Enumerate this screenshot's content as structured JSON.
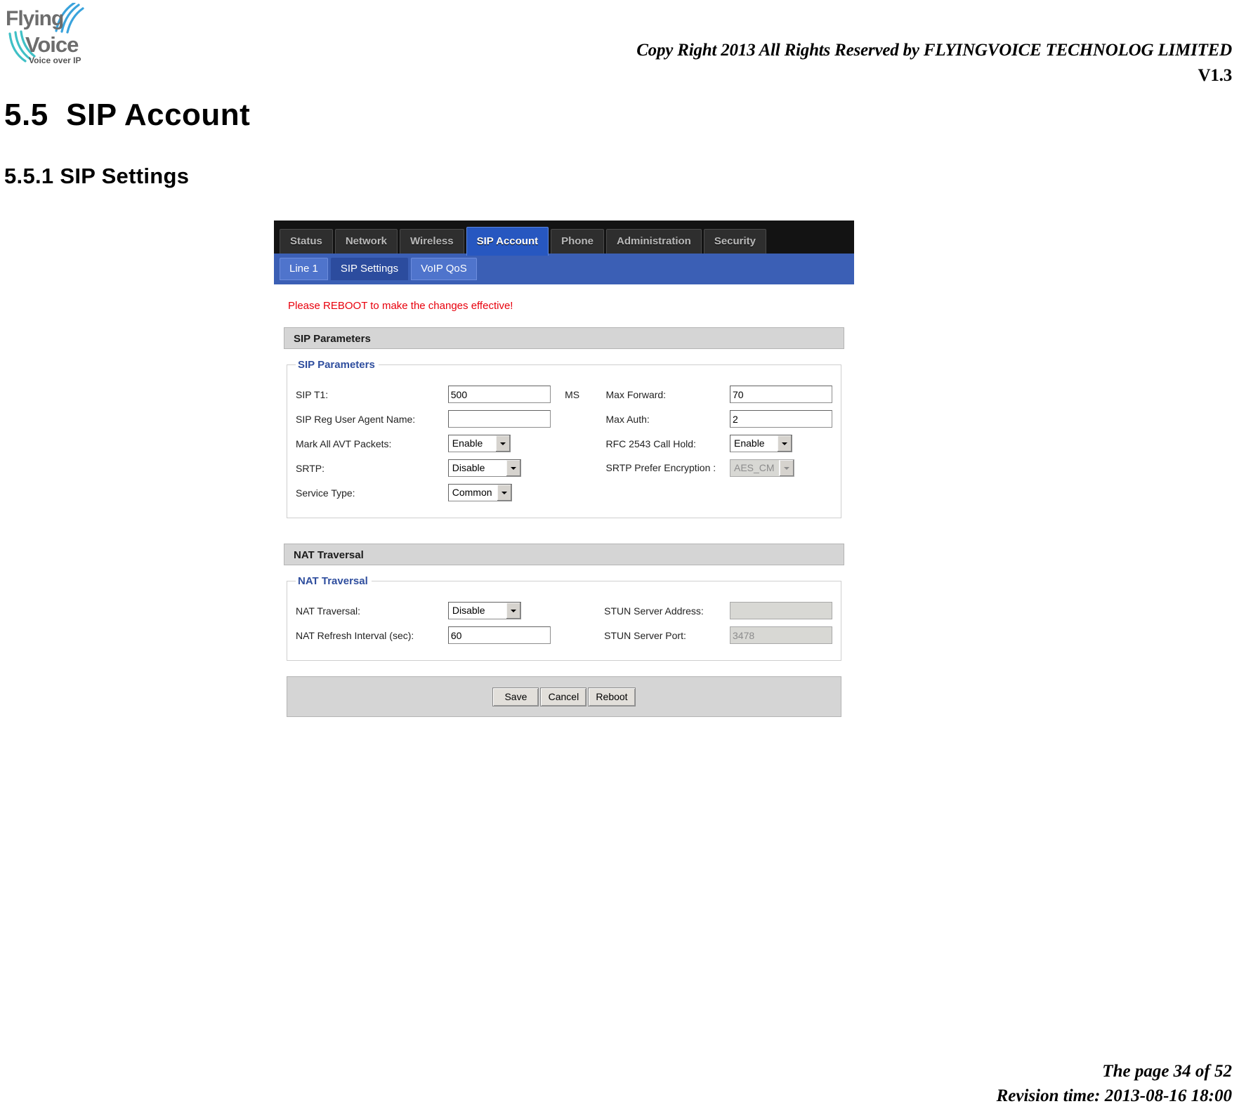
{
  "document": {
    "header_copyright": "Copy Right 2013 All Rights Reserved by FLYINGVOICE TECHNOLOG LIMITED",
    "header_version": "V1.3",
    "logo_alt": "Flying Voice — Voice over IP",
    "logo_line1": "Flying",
    "logo_line2": "Voice",
    "logo_tagline": "Voice over IP",
    "section_title": "5.5  SIP Account",
    "subsection_title": "5.5.1 SIP Settings",
    "footer_page": "The page 34 of 52",
    "footer_revision": "Revision time: 2013-08-16 18:00"
  },
  "webui": {
    "nav_tabs": [
      {
        "label": "Status",
        "active": false
      },
      {
        "label": "Network",
        "active": false
      },
      {
        "label": "Wireless",
        "active": false
      },
      {
        "label": "SIP Account",
        "active": true
      },
      {
        "label": "Phone",
        "active": false
      },
      {
        "label": "Administration",
        "active": false
      },
      {
        "label": "Security",
        "active": false
      }
    ],
    "sub_tabs": [
      {
        "label": "Line 1",
        "active": false
      },
      {
        "label": "SIP Settings",
        "active": true
      },
      {
        "label": "VoIP QoS",
        "active": false
      }
    ],
    "warning": "Please REBOOT to make the changes effective!",
    "panels": [
      {
        "bar_title": "SIP Parameters",
        "group_title": "SIP Parameters",
        "rows": [
          {
            "left_label": "SIP T1:",
            "left_type": "text",
            "left_value": "500",
            "left_unit": "MS",
            "right_label": "Max Forward:",
            "right_type": "text",
            "right_value": "70"
          },
          {
            "left_label": "SIP Reg User Agent Name:",
            "left_type": "text",
            "left_value": "",
            "left_unit": "",
            "right_label": "Max Auth:",
            "right_type": "text",
            "right_value": "2"
          },
          {
            "left_label": "Mark All AVT Packets:",
            "left_type": "select",
            "left_value": "Enable",
            "left_unit": "",
            "right_label": "RFC 2543 Call Hold:",
            "right_type": "select",
            "right_value": "Enable"
          },
          {
            "left_label": "SRTP:",
            "left_type": "select",
            "left_value": "Disable",
            "left_unit": "",
            "right_label": "SRTP Prefer Encryption :",
            "right_type": "select-disabled",
            "right_value": "AES_CM"
          },
          {
            "left_label": "Service Type:",
            "left_type": "select",
            "left_value": "Common",
            "left_unit": "",
            "right_label": "",
            "right_type": "none",
            "right_value": ""
          }
        ]
      },
      {
        "bar_title": "NAT Traversal",
        "group_title": "NAT Traversal",
        "rows": [
          {
            "left_label": "NAT Traversal:",
            "left_type": "select",
            "left_value": "Disable",
            "left_unit": "",
            "right_label": "STUN Server Address:",
            "right_type": "text-disabled",
            "right_value": ""
          },
          {
            "left_label": "NAT Refresh Interval (sec):",
            "left_type": "text",
            "left_value": "60",
            "left_unit": "",
            "right_label": "STUN Server Port:",
            "right_type": "text-disabled",
            "right_value": "3478"
          }
        ]
      }
    ],
    "buttons": [
      {
        "label": "Save"
      },
      {
        "label": "Cancel"
      },
      {
        "label": "Reboot"
      }
    ]
  },
  "colors": {
    "nav_bg": "#131313",
    "nav_active": "#2757c0",
    "subnav_bg": "#3b5fb5",
    "subnav_active": "#2c4c9e",
    "panel_bar": "#d5d5d5",
    "warning_red": "#e8000c",
    "legend_blue": "#2f4e9e"
  }
}
